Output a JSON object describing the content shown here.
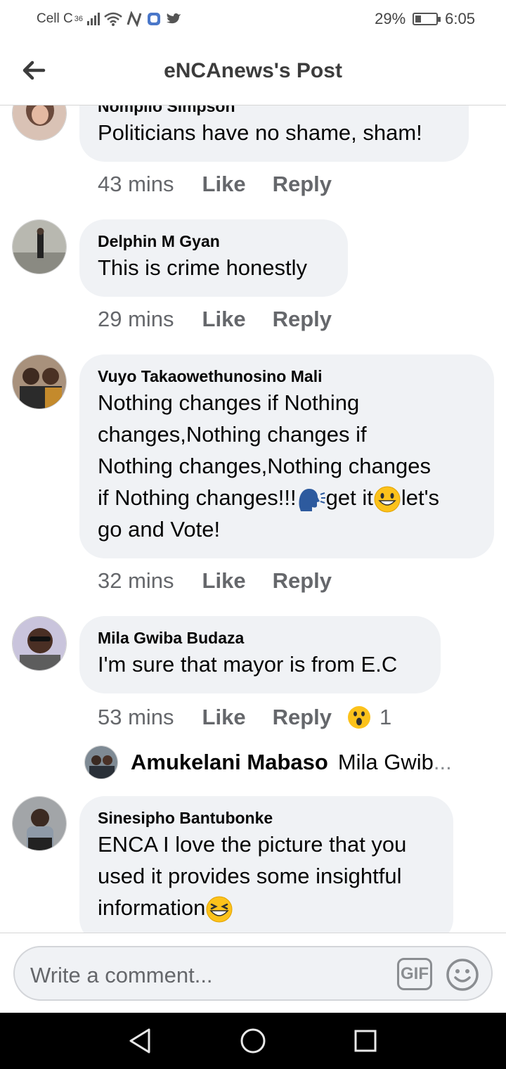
{
  "status": {
    "carrier": "Cell C",
    "network": "36",
    "battery": "29%",
    "battery_level": 0.29,
    "time": "6:05"
  },
  "header": {
    "title": "eNCAnews's Post"
  },
  "comments": [
    {
      "author": "Nomplio Simpson",
      "text": "Politicians have no shame, sham!",
      "time": "43 mins",
      "like": "Like",
      "reply": "Reply"
    },
    {
      "author": "Delphin M Gyan",
      "text": "This is crime honestly",
      "time": "29 mins",
      "like": "Like",
      "reply": "Reply"
    },
    {
      "author": "Vuyo Takaowethunosino Mali",
      "text_lines": [
        "Nothing changes if Nothing",
        "changes,Nothing changes if",
        "Nothing changes,Nothing changes",
        "if Nothing changes!!!",
        "get it",
        "let's",
        "go and Vote!"
      ],
      "time": "32 mins",
      "like": "Like",
      "reply": "Reply"
    },
    {
      "author": "Mila Gwiba Budaza",
      "text": "I'm sure that mayor is from E.C",
      "time": "53 mins",
      "like": "Like",
      "reply": "Reply",
      "reaction_count": "1",
      "reply_preview": {
        "author": "Amukelani Mabaso",
        "text": "Mila Gwib",
        "ellipsis": "..."
      }
    },
    {
      "author": "Sinesipho Bantubonke",
      "text_lines": [
        "ENCA I love the picture that you",
        "used it provides some insightful",
        "information"
      ]
    }
  ],
  "composer": {
    "placeholder": "Write a comment...",
    "gif": "GIF"
  },
  "icons": [
    "back-arrow-icon",
    "gif-icon",
    "emoji-icon",
    "nav-back-icon",
    "nav-home-icon",
    "nav-recents-icon"
  ]
}
